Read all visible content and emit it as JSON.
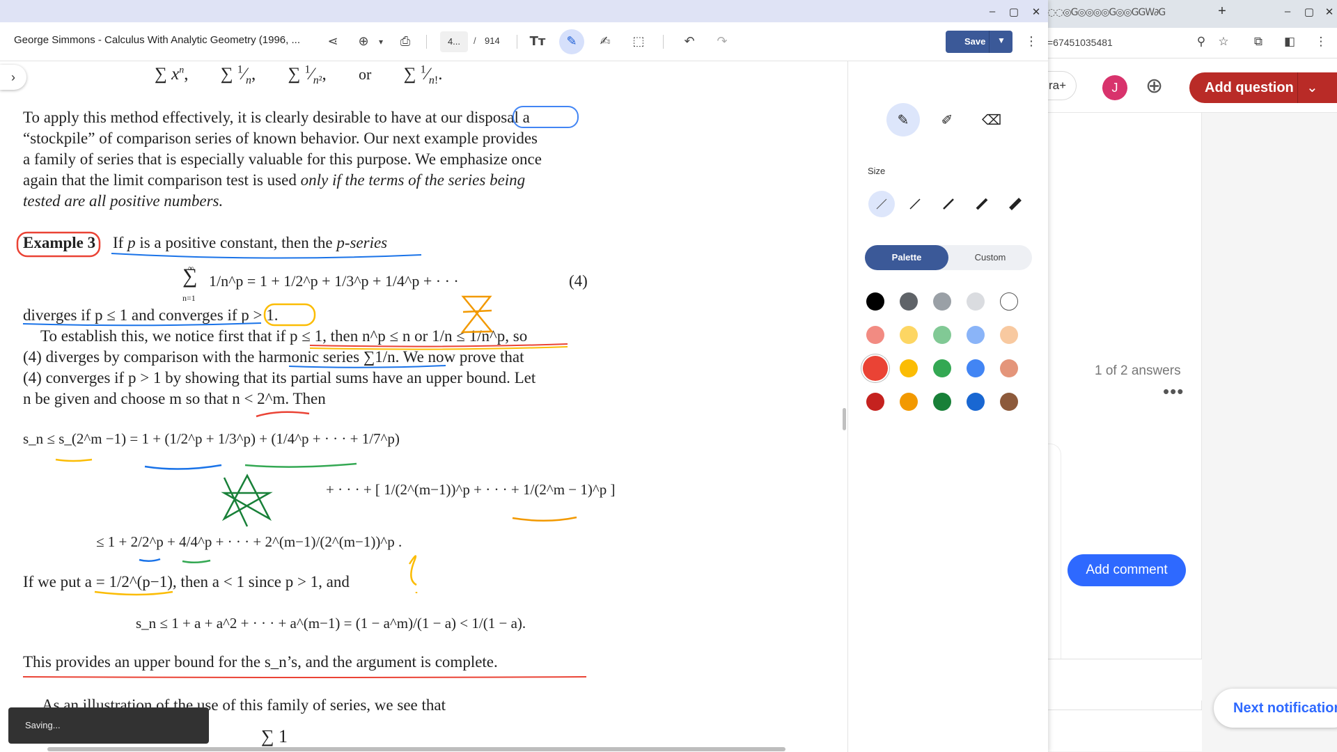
{
  "background_browser": {
    "url_fragment": "=67451035481",
    "quora_plus_label": "ra+",
    "avatar_letter": "J",
    "add_question_label": "Add question",
    "answers_count": "1 of 2 answers",
    "more_label": "•••",
    "add_comment_label": "Add comment",
    "next_notification_label": "Next notification"
  },
  "pdf_viewer": {
    "document_title": "George Simmons - Calculus With Analytic Geometry (1996, ...",
    "page_input_value": "4...",
    "page_separator": "/",
    "page_total": "914",
    "save_label": "Save",
    "saving_toast": "Saving..."
  },
  "draw_panel": {
    "size_label": "Size",
    "palette_tab": "Palette",
    "custom_tab": "Custom",
    "selected_tool": "pen",
    "selected_color": "#ea4335",
    "stroke_sizes": 5,
    "colors": [
      [
        "#000000",
        "#5f6368",
        "#9aa0a6",
        "#dadce0",
        "#ffffff"
      ],
      [
        "#f28b82",
        "#fdd663",
        "#81c995",
        "#8ab4f8",
        "#f8c9a0"
      ],
      [
        "#ea4335",
        "#fbbc04",
        "#34a853",
        "#4285f4",
        "#e4957a"
      ],
      [
        "#c5221f",
        "#f29900",
        "#188038",
        "#1967d2",
        "#8d5a3b"
      ]
    ]
  },
  "page": {
    "sum_row": [
      "∑ x",
      "n",
      ",",
      "∑",
      "1",
      "n",
      ",",
      "∑",
      "1",
      "n",
      "2",
      ",",
      "or",
      "∑",
      "1",
      "n!",
      "."
    ],
    "p1": [
      "To apply this method effectively, it is clearly desirable to have at our disposal a",
      "“stockpile” of comparison series of known behavior. Our next example provides",
      "a family of series that is especially valuable for this purpose. We emphasize once",
      "again that the limit comparison test is used ",
      "only if the terms of the series being",
      "tested are all positive numbers."
    ],
    "example_label": "Example 3",
    "example_text_a": "If ",
    "example_text_p": "p",
    "example_text_b": " is a positive constant, then the ",
    "example_text_c": "p-series",
    "eq4_lhs": "∑",
    "eq4_sup": "∞",
    "eq4_sub": "n=1",
    "eq4_rhs": "1/n^p = 1 + 1/2^p + 1/3^p + 1/4^p + · · ·",
    "eq4_number": "(4)",
    "diverges_line": "diverges if p ≤ 1 and converges if p > 1.",
    "p2": [
      "To establish this, we notice first that if p ≤ 1, then n^p ≤ n or 1/n ≤ 1/n^p, so",
      "(4) diverges by comparison with the harmonic series ∑1/n. We now prove that",
      "(4) converges if p > 1 by showing that its partial sums have an upper bound. Let",
      "n be given and choose m so that n < 2^m. Then"
    ],
    "ineq1": "s_n ≤ s_(2^m −1) = 1 + (1/2^p + 1/3^p) + (1/4^p + · · · + 1/7^p)",
    "ineq2": "+ · · · + [ 1/(2^(m−1))^p + · · · + 1/(2^m − 1)^p ]",
    "ineq3": "≤ 1 + 2/2^p + 4/4^p + · · · + 2^(m−1)/(2^(m−1))^p .",
    "p3": "If we put a = 1/2^(p−1), then a < 1 since p > 1, and",
    "ineq4": "s_n ≤ 1 + a + a^2 + · · · + a^(m−1) = (1 − a^m)/(1 − a) < 1/(1 − a).",
    "p4": "This provides an upper bound for the s_n’s, and the argument is complete.",
    "p5": "As an illustration of the use of this family of series, we see that",
    "last_frac": "∑ 1"
  }
}
